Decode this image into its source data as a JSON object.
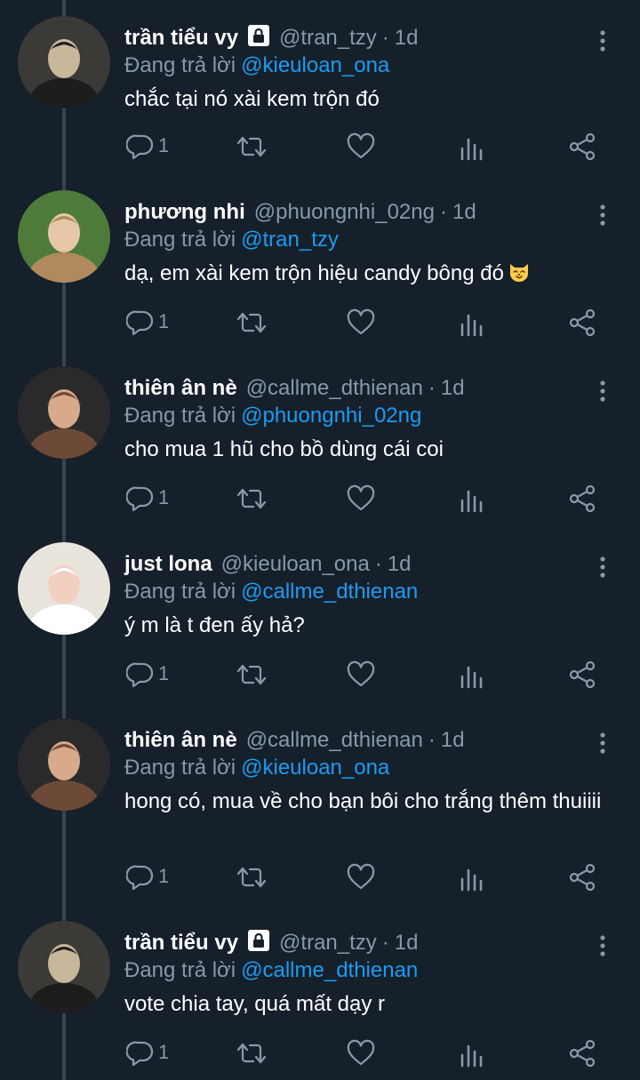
{
  "colors": {
    "background": "#15202b",
    "secondary_text": "#8899a6",
    "mention": "#1d9bf0",
    "thread_line": "#38444d"
  },
  "replying_prefix": "Đang trả lời",
  "tweets": [
    {
      "name": "trần tiểu vy",
      "locked": true,
      "handle": "@tran_tzy",
      "time": "1d",
      "replying_to": "@kieuloan_ona",
      "text": "chắc tại nó xài kem trộn đó",
      "text_emoji": "",
      "reply_count": "1"
    },
    {
      "name": "phương nhi",
      "locked": false,
      "handle": "@phuongnhi_02ng",
      "time": "1d",
      "replying_to": "@tran_tzy",
      "text": "dạ, em xài kem trộn hiệu candy bông đó",
      "text_emoji": "cat-face-emoji",
      "reply_count": "1"
    },
    {
      "name": "thiên ân nè",
      "locked": false,
      "handle": "@callme_dthienan",
      "time": "1d",
      "replying_to": "@phuongnhi_02ng",
      "text": "cho mua 1 hũ cho bồ dùng cái coi",
      "text_emoji": "",
      "reply_count": "1"
    },
    {
      "name": "just lona",
      "locked": false,
      "handle": "@kieuloan_ona",
      "time": "1d",
      "replying_to": "@callme_dthienan",
      "text": "ý m là t đen ấy hả?",
      "text_emoji": "",
      "reply_count": "1"
    },
    {
      "name": "thiên ân nè",
      "locked": false,
      "handle": "@callme_dthienan",
      "time": "1d",
      "replying_to": "@kieuloan_ona",
      "text": "hong có, mua về cho bạn bôi cho trắng thêm thuiiii",
      "text_emoji": "",
      "reply_count": "1"
    },
    {
      "name": "trần tiểu vy",
      "locked": true,
      "handle": "@tran_tzy",
      "time": "1d",
      "replying_to": "@callme_dthienan",
      "text": "vote chia tay, quá mất dạy r",
      "text_emoji": "",
      "reply_count": "1"
    }
  ]
}
